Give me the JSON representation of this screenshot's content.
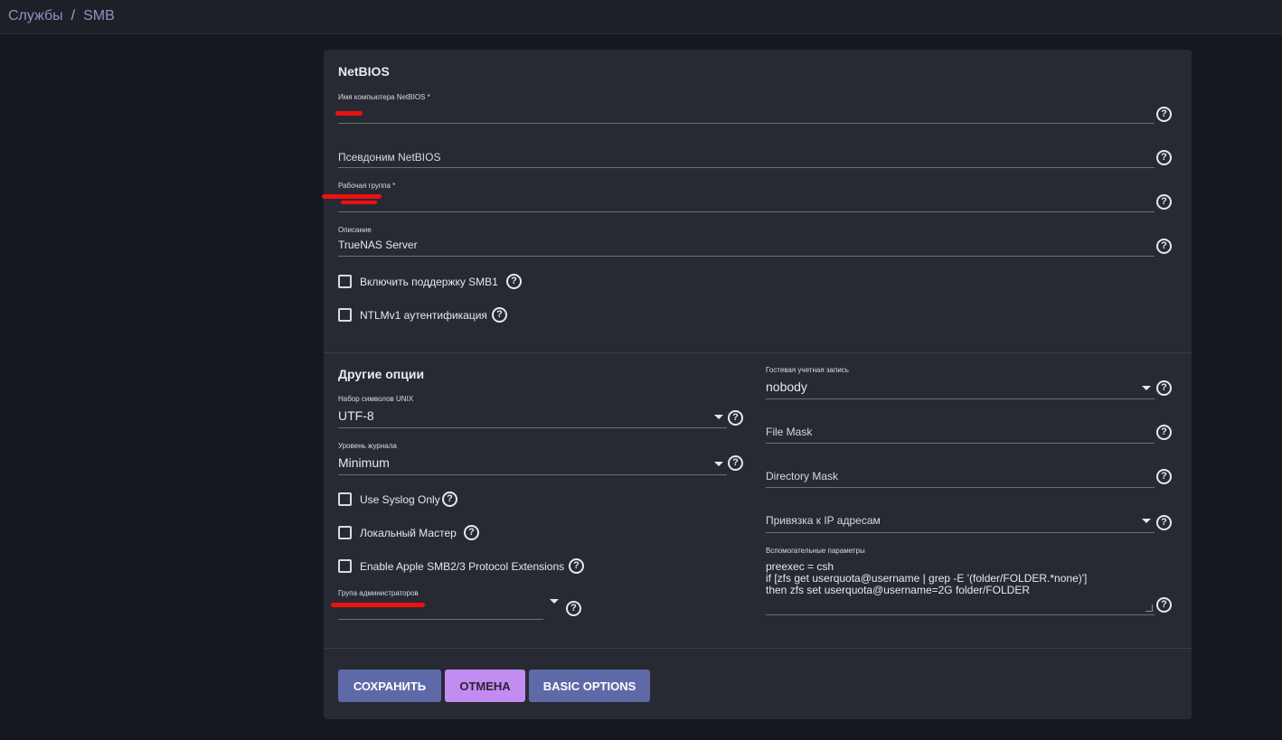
{
  "breadcrumb": {
    "items": [
      "Службы",
      "SMB"
    ],
    "separator": "/"
  },
  "netbios": {
    "title": "NetBIOS",
    "name_label": "Имя компьютера NetBIOS *",
    "name_value": "",
    "alias_placeholder": "Псевдоним NetBIOS",
    "workgroup_label": "Рабочая группа *",
    "workgroup_value": "",
    "description_label": "Описание",
    "description_value": "TrueNAS Server",
    "smb1_label": "Включить поддержку SMB1",
    "smb1_checked": false,
    "ntlm_label": "NTLMv1 аутентификация",
    "ntlm_checked": false
  },
  "other": {
    "title": "Другие опции",
    "unix_charset_label": "Набор символов UNIX",
    "unix_charset_value": "UTF-8",
    "log_level_label": "Уровень журнала",
    "log_level_value": "Minimum",
    "syslog_label": "Use Syslog Only",
    "syslog_checked": false,
    "local_master_label": "Локальный Мастер",
    "local_master_checked": false,
    "apple_ext_label": "Enable Apple SMB2/3 Protocol Extensions",
    "apple_ext_checked": false,
    "admin_group_label": "Група администраторов",
    "admin_group_value": "",
    "guest_label": "Гостевая учетная запись",
    "guest_value": "nobody",
    "file_mask_placeholder": "File Mask",
    "dir_mask_placeholder": "Directory Mask",
    "bind_ip_placeholder": "Привязка к IP адресам",
    "aux_label": "Вспомогательные параметры",
    "aux_value": "preexec = csh\nif [zfs get userquota@username | grep -E '(folder/FOLDER.*none)']\nthen zfs set userquota@username=2G folder/FOLDER"
  },
  "buttons": {
    "save": "СОХРАНИТЬ",
    "cancel": "ОТМЕНА",
    "basic": "BASIC OPTIONS"
  },
  "colors": {
    "save_bg": "#5e6aa8",
    "cancel_bg": "#c28cf0",
    "basic_bg": "#5e6aa8",
    "redaction": "#ee1111"
  },
  "icons": {
    "help": "?"
  }
}
